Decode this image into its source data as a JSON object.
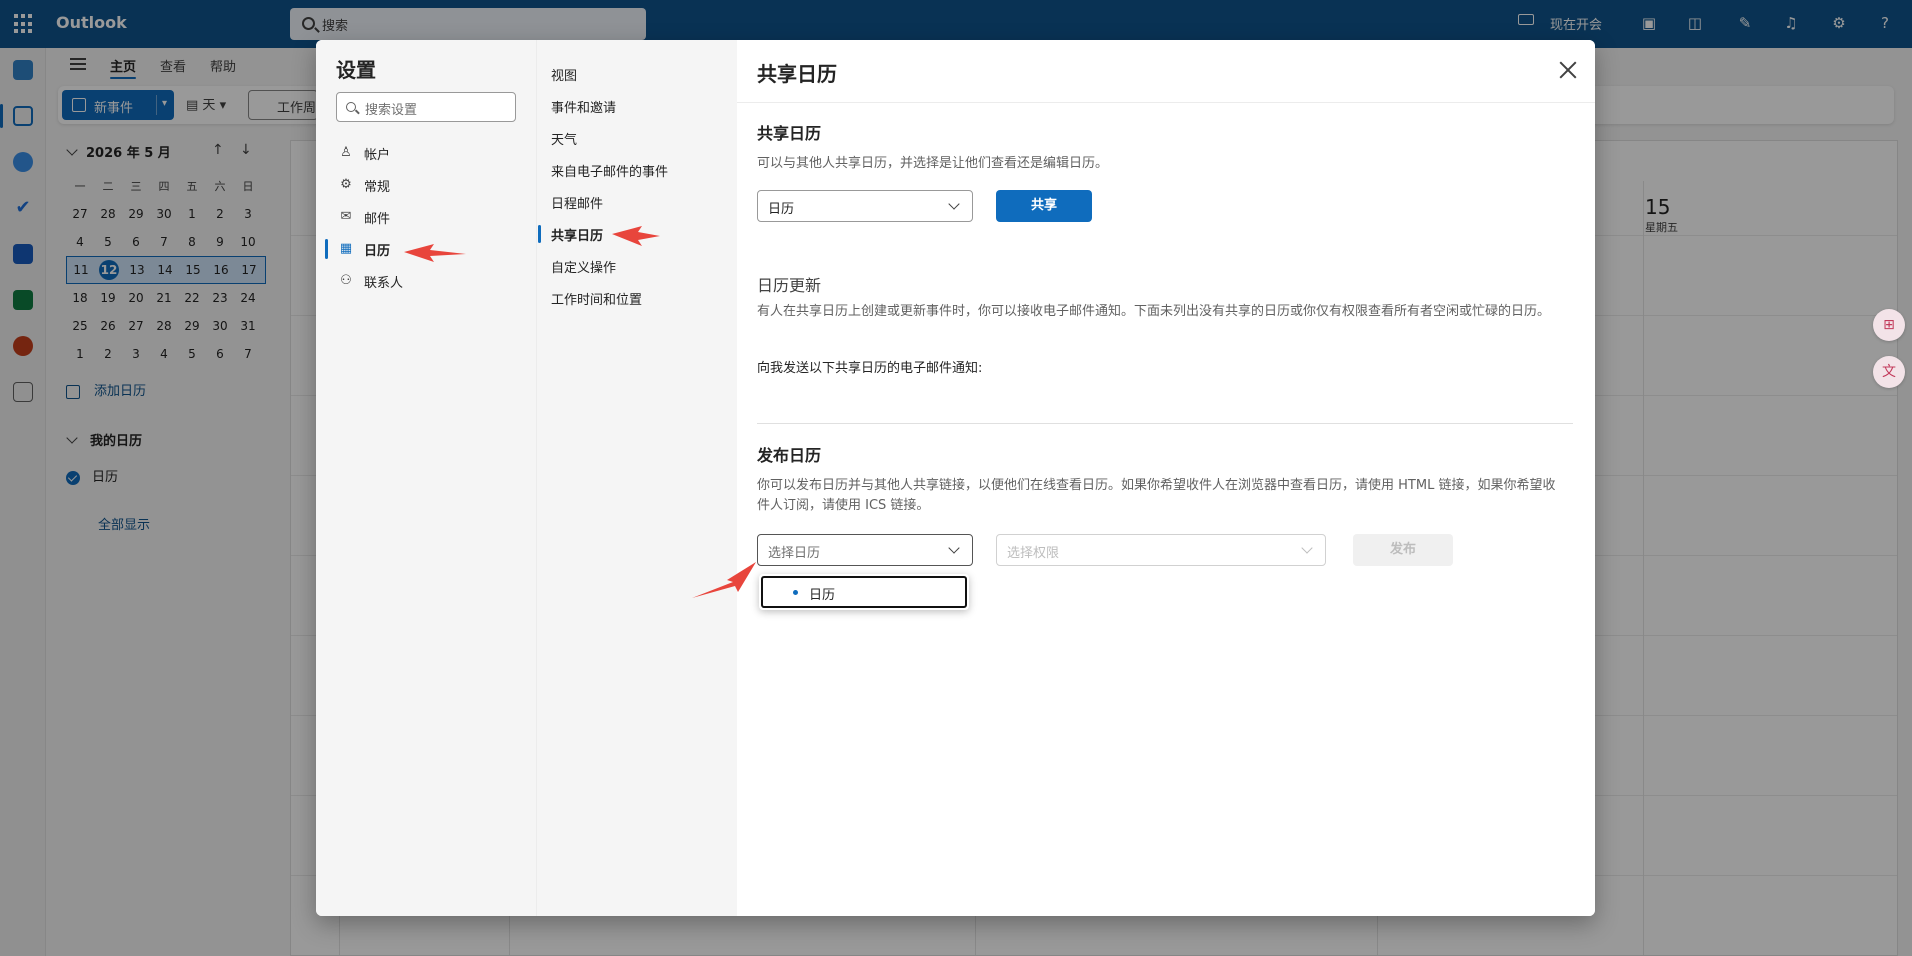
{
  "app": {
    "name": "Outlook"
  },
  "search": {
    "placeholder": "搜索"
  },
  "topbar": {
    "meet_now": "现在开会"
  },
  "ribbon": {
    "tabs": [
      "主页",
      "查看",
      "帮助"
    ],
    "new_event": "新事件",
    "day": "天",
    "work_week": "工作周"
  },
  "mini_calendar": {
    "title": "2026 年 5 月",
    "days_of_week": [
      "一",
      "二",
      "三",
      "四",
      "五",
      "六",
      "日"
    ],
    "weeks": [
      [
        "27",
        "28",
        "29",
        "30",
        "1",
        "2",
        "3"
      ],
      [
        "4",
        "5",
        "6",
        "7",
        "8",
        "9",
        "10"
      ],
      [
        "11",
        "12",
        "13",
        "14",
        "15",
        "16",
        "17"
      ],
      [
        "18",
        "19",
        "20",
        "21",
        "22",
        "23",
        "24"
      ],
      [
        "25",
        "26",
        "27",
        "28",
        "29",
        "30",
        "31"
      ],
      [
        "1",
        "2",
        "3",
        "4",
        "5",
        "6",
        "7"
      ]
    ],
    "today": "12"
  },
  "nav": {
    "add_calendar": "添加日历",
    "my_calendars": "我的日历",
    "calendar_item": "日历",
    "show_all": "全部显示"
  },
  "calendar_view": {
    "day_number": "15",
    "day_name": "星期五"
  },
  "settings": {
    "title": "设置",
    "search_placeholder": "搜索设置",
    "categories": [
      {
        "label": "帐户",
        "icon": "person-icon"
      },
      {
        "label": "常规",
        "icon": "gear-icon"
      },
      {
        "label": "邮件",
        "icon": "mail-icon"
      },
      {
        "label": "日历",
        "icon": "calendar-icon"
      },
      {
        "label": "联系人",
        "icon": "people-icon"
      }
    ],
    "subcategories": [
      "视图",
      "事件和邀请",
      "天气",
      "来自电子邮件的事件",
      "日程邮件",
      "共享日历",
      "自定义操作",
      "工作时间和位置"
    ]
  },
  "panel": {
    "title": "共享日历",
    "share_section": {
      "heading": "共享日历",
      "description": "可以与其他人共享日历，并选择是让他们查看还是编辑日历。",
      "calendar_value": "日历",
      "share_button": "共享"
    },
    "updates_section": {
      "heading": "日历更新",
      "description": "有人在共享日历上创建或更新事件时，你可以接收电子邮件通知。下面未列出没有共享的日历或你仅有权限查看所有者空闲或忙碌的日历。",
      "notify_label": "向我发送以下共享日历的电子邮件通知:"
    },
    "publish_section": {
      "heading": "发布日历",
      "description": "你可以发布日历并与其他人共享链接，以便他们在线查看日历。如果你希望收件人在浏览器中查看日历，请使用 HTML 链接，如果你希望收件人订阅，请使用 ICS 链接。",
      "select_calendar_placeholder": "选择日历",
      "select_permission_placeholder": "选择权限",
      "publish_button": "发布",
      "dropdown_option": "日历"
    }
  },
  "colors": {
    "brand": "#0f548c",
    "accent": "#0f6cbd",
    "annotation_arrow": "#e8453c"
  }
}
